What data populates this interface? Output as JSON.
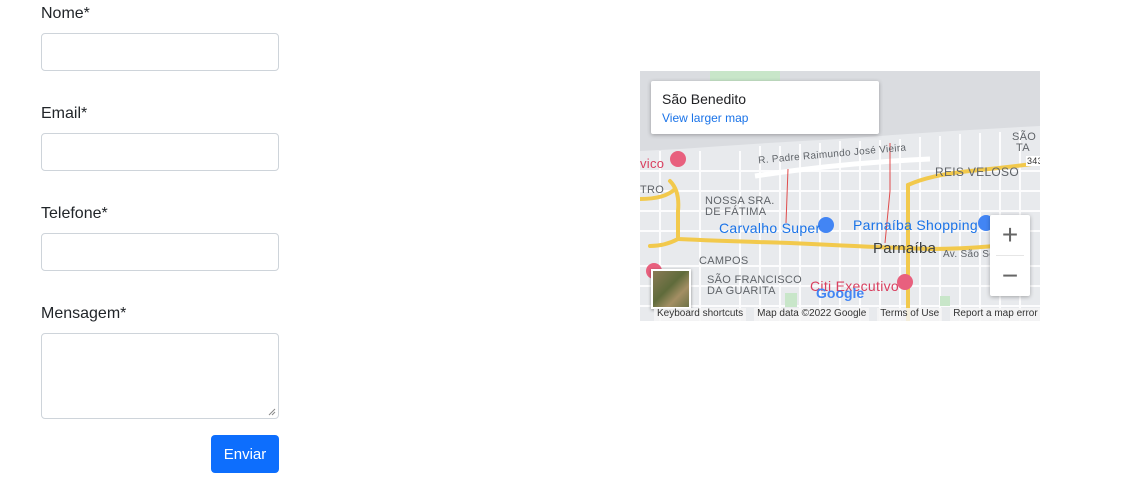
{
  "form": {
    "name_label": "Nome*",
    "email_label": "Email*",
    "phone_label": "Telefone*",
    "message_label": "Mensagem*",
    "name_value": "",
    "email_value": "",
    "phone_value": "",
    "message_value": "",
    "submit_label": "Enviar"
  },
  "map": {
    "place_title": "São Benedito",
    "view_larger_link": "View larger map",
    "zoom_in": "+",
    "zoom_out": "−",
    "labels": {
      "road_north": "R. Padre Raimundo José Vieira",
      "reis_veloso": "REIS VELOSO",
      "nossa_sra_1": "NOSSA SRA.",
      "nossa_sra_2": "DE FÁTIMA",
      "carvalho": "Carvalho Super",
      "parnaiba_shopping": "Parnaíba Shopping",
      "parnaiba": "Parnaíba",
      "av_sao_se": "Av. São Se",
      "campos": "CAMPOS",
      "sao_francisco_1": "SÃO FRANCISCO",
      "sao_francisco_2": "DA GUARITA",
      "citi": "Citi Executivo",
      "vico": "vico",
      "tro": "TRO",
      "sao_1": "SÃO",
      "sao_2": "TA",
      "route": "343"
    },
    "logo": "Google",
    "footer": {
      "shortcuts": "Keyboard shortcuts",
      "map_data": "Map data ©2022 Google",
      "terms": "Terms of Use",
      "report": "Report a map error"
    }
  }
}
